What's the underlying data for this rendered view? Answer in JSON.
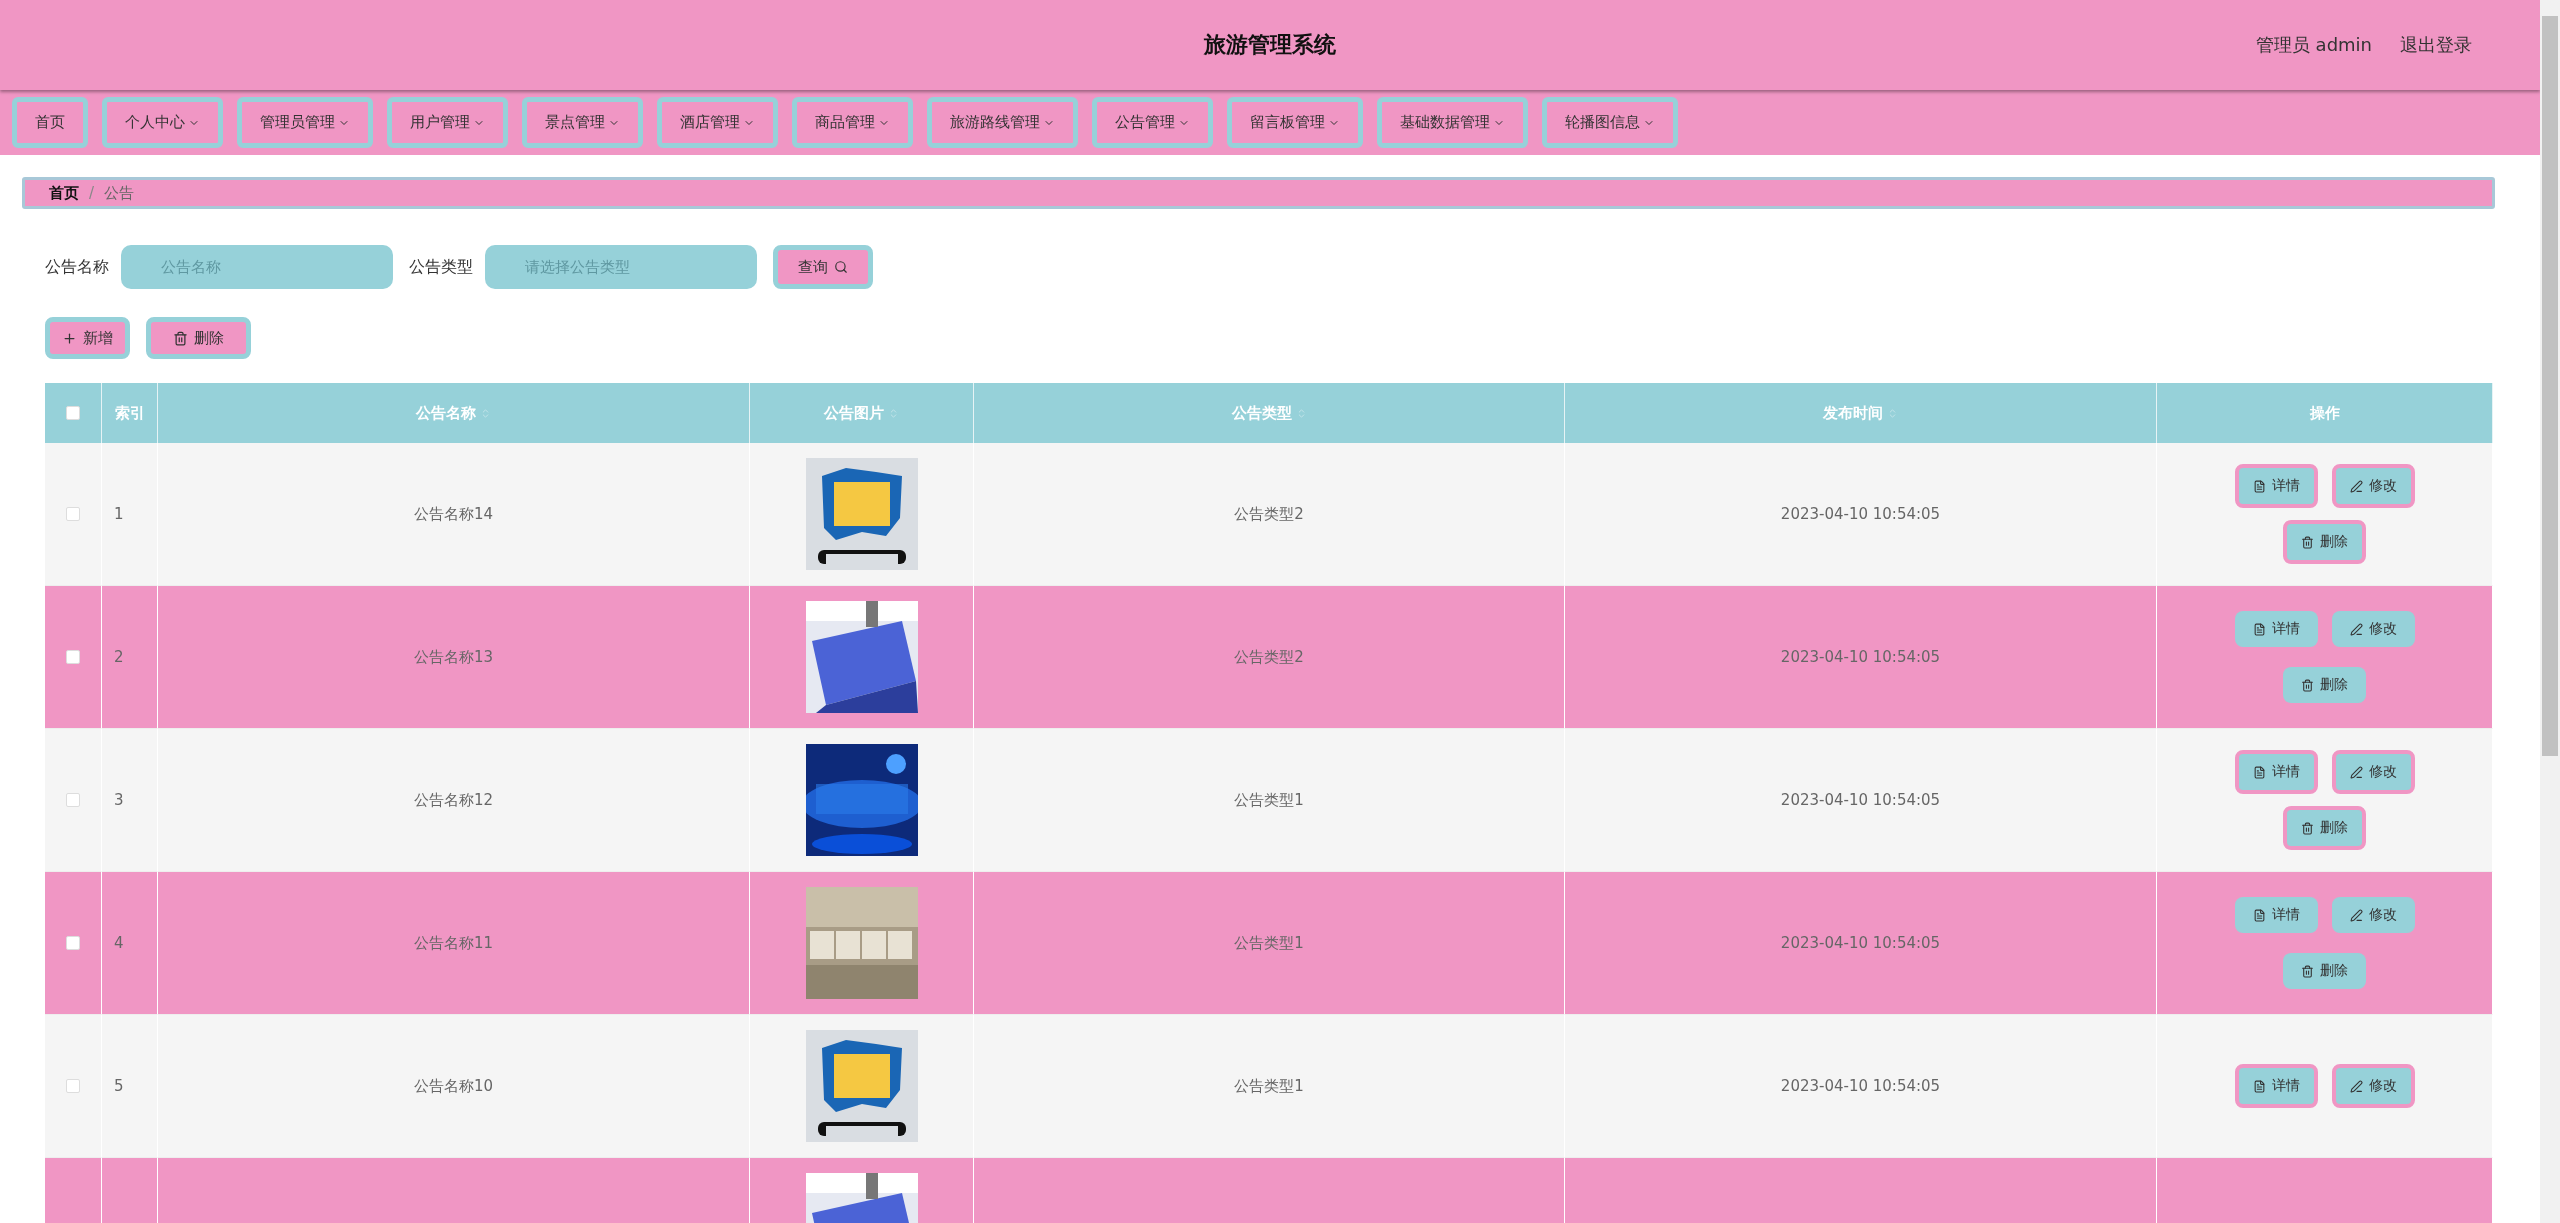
{
  "header": {
    "title": "旅游管理系统",
    "user": "管理员 admin",
    "logout": "退出登录"
  },
  "nav": [
    {
      "label": "首页",
      "dropdown": false
    },
    {
      "label": "个人中心",
      "dropdown": true
    },
    {
      "label": "管理员管理",
      "dropdown": true
    },
    {
      "label": "用户管理",
      "dropdown": true
    },
    {
      "label": "景点管理",
      "dropdown": true
    },
    {
      "label": "酒店管理",
      "dropdown": true
    },
    {
      "label": "商品管理",
      "dropdown": true
    },
    {
      "label": "旅游路线管理",
      "dropdown": true
    },
    {
      "label": "公告管理",
      "dropdown": true
    },
    {
      "label": "留言板管理",
      "dropdown": true
    },
    {
      "label": "基础数据管理",
      "dropdown": true
    },
    {
      "label": "轮播图信息",
      "dropdown": true
    }
  ],
  "breadcrumb": {
    "separator": "/",
    "items": [
      {
        "label": "首页",
        "current": false
      },
      {
        "label": "公告",
        "current": true
      }
    ]
  },
  "search": {
    "fields": [
      {
        "label": "公告名称",
        "placeholder": "公告名称"
      },
      {
        "label": "公告类型",
        "placeholder": "请选择公告类型"
      }
    ],
    "button": "查询"
  },
  "actions": [
    {
      "label": "新增",
      "kind": "add"
    },
    {
      "label": "删除",
      "kind": "delete"
    }
  ],
  "table": {
    "select_all": {
      "checked": false
    },
    "columns": [
      {
        "label": "索引",
        "sortable": false
      },
      {
        "label": "公告名称",
        "sortable": true
      },
      {
        "label": "公告图片",
        "sortable": true
      },
      {
        "label": "公告类型",
        "sortable": true
      },
      {
        "label": "发布时间",
        "sortable": true
      },
      {
        "label": "操作",
        "sortable": false
      }
    ],
    "rows": [
      {
        "checked": false,
        "index": "1",
        "name": "公告名称14",
        "picture": {
          "kind": "picture"
        },
        "type": "公告类型2",
        "time": "2023-04-10 10:54:05",
        "buttons": [
          {
            "label": "详情",
            "kind": "detail"
          },
          {
            "label": "修改",
            "kind": "edit"
          },
          {
            "label": "删除",
            "kind": "delete"
          }
        ]
      },
      {
        "checked": false,
        "index": "2",
        "name": "公告名称13",
        "picture": {
          "kind": "picture"
        },
        "type": "公告类型2",
        "time": "2023-04-10 10:54:05",
        "buttons": [
          {
            "label": "详情",
            "kind": "detail"
          },
          {
            "label": "修改",
            "kind": "edit"
          },
          {
            "label": "删除",
            "kind": "delete"
          }
        ]
      },
      {
        "checked": false,
        "index": "3",
        "name": "公告名称12",
        "picture": {
          "kind": "picture"
        },
        "type": "公告类型1",
        "time": "2023-04-10 10:54:05",
        "buttons": [
          {
            "label": "详情",
            "kind": "detail"
          },
          {
            "label": "修改",
            "kind": "edit"
          },
          {
            "label": "删除",
            "kind": "delete"
          }
        ]
      },
      {
        "checked": false,
        "index": "4",
        "name": "公告名称11",
        "picture": {
          "kind": "picture"
        },
        "type": "公告类型1",
        "time": "2023-04-10 10:54:05",
        "buttons": [
          {
            "label": "详情",
            "kind": "detail"
          },
          {
            "label": "修改",
            "kind": "edit"
          },
          {
            "label": "删除",
            "kind": "delete"
          }
        ]
      },
      {
        "checked": false,
        "index": "5",
        "name": "公告名称10",
        "picture": {
          "kind": "picture"
        },
        "type": "公告类型1",
        "time": "2023-04-10 10:54:05",
        "buttons": [
          {
            "label": "详情",
            "kind": "detail"
          },
          {
            "label": "修改",
            "kind": "edit"
          }
        ]
      },
      {
        "picture": {
          "kind": "picture"
        }
      }
    ]
  }
}
